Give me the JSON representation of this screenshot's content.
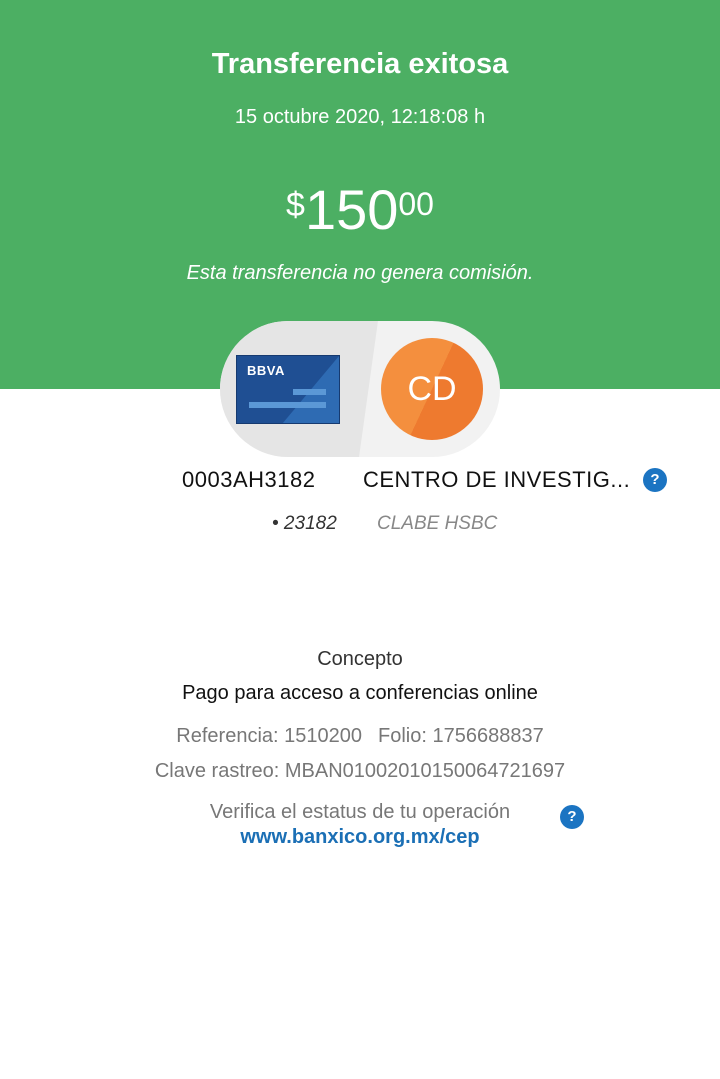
{
  "header": {
    "title": "Transferencia exitosa",
    "datetime": "15 octubre 2020, 12:18:08 h",
    "amount": {
      "currency_symbol": "$",
      "integer": "150",
      "decimals": "00"
    },
    "commission_note": "Esta transferencia no genera comisión.",
    "background_color": "#4caf63"
  },
  "origin": {
    "bank_logo_text": "BBVA",
    "account": "0003AH3182",
    "account_detail": "• 23182"
  },
  "destination": {
    "avatar_initials": "CD",
    "name": "CENTRO DE INVESTIG...",
    "account_type": "CLABE HSBC",
    "help_icon": "?"
  },
  "details": {
    "concept_label": "Concepto",
    "concept_value": "Pago para acceso a conferencias online",
    "reference": "Referencia: 1510200",
    "folio": "Folio: 1756688837",
    "tracking_key": "Clave rastreo: MBAN01002010150064721697"
  },
  "verify": {
    "text": "Verifica el estatus de tu operación",
    "link": "www.banxico.org.mx/cep",
    "help_icon": "?"
  },
  "colors": {
    "accent_blue": "#1b74c2",
    "avatar_orange": "#f48f3e"
  }
}
